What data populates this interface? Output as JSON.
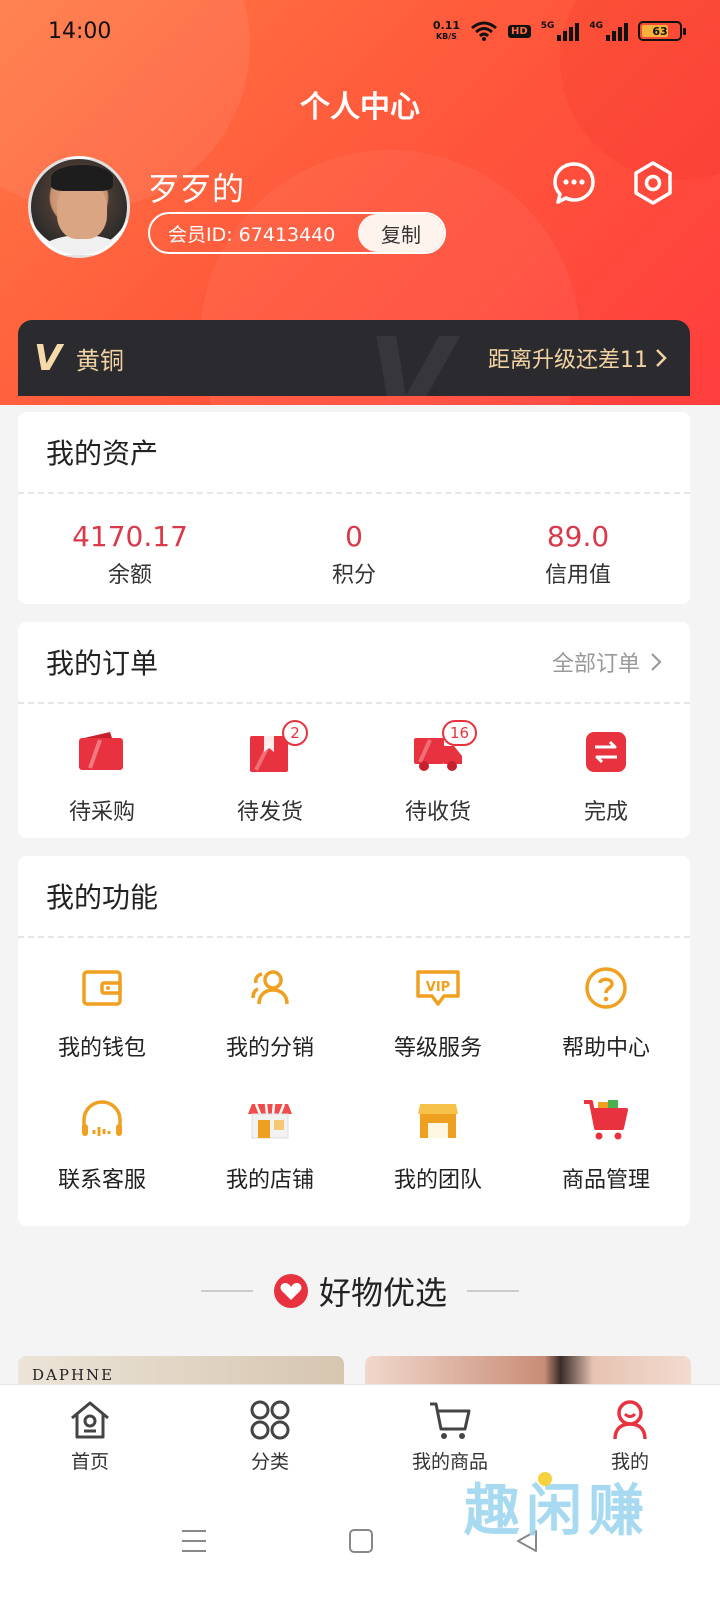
{
  "status_bar": {
    "time": "14:00",
    "net_speed_value": "0.11",
    "net_speed_unit": "KB/S",
    "hd_badge": "HD",
    "sig1_label": "5G",
    "sig2_label": "4G",
    "battery": "63"
  },
  "header": {
    "title": "个人中心"
  },
  "profile": {
    "username": "歹歹的",
    "member_id": "会员ID: 67413440",
    "copy_label": "复制"
  },
  "level": {
    "name": "黄铜",
    "upgrade_text": "距离升级还差11"
  },
  "assets": {
    "title": "我的资产",
    "items": [
      {
        "value": "4170.17",
        "label": "余额"
      },
      {
        "value": "0",
        "label": "积分"
      },
      {
        "value": "89.0",
        "label": "信用值"
      }
    ]
  },
  "orders": {
    "title": "我的订单",
    "all_label": "全部订单",
    "items": [
      {
        "label": "待采购",
        "badge": "",
        "icon": "wallet-icon"
      },
      {
        "label": "待发货",
        "badge": "2",
        "icon": "package-icon"
      },
      {
        "label": "待收货",
        "badge": "16",
        "icon": "truck-icon"
      },
      {
        "label": "完成",
        "badge": "",
        "icon": "exchange-icon"
      }
    ]
  },
  "functions": {
    "title": "我的功能",
    "items": [
      {
        "label": "我的钱包",
        "icon": "wallet-outline-icon"
      },
      {
        "label": "我的分销",
        "icon": "users-icon"
      },
      {
        "label": "等级服务",
        "icon": "vip-icon"
      },
      {
        "label": "帮助中心",
        "icon": "help-icon"
      },
      {
        "label": "联系客服",
        "icon": "headset-icon"
      },
      {
        "label": "我的店铺",
        "icon": "shop-icon"
      },
      {
        "label": "我的团队",
        "icon": "storefront-icon"
      },
      {
        "label": "商品管理",
        "icon": "cart-icon"
      }
    ]
  },
  "featured": {
    "title": "好物优选",
    "product1_brand": "DAPHNE"
  },
  "bottom_nav": {
    "items": [
      {
        "label": "首页",
        "icon": "home-icon"
      },
      {
        "label": "分类",
        "icon": "grid-icon"
      },
      {
        "label": "我的商品",
        "icon": "cart-outline-icon"
      },
      {
        "label": "我的",
        "icon": "user-icon",
        "active": true
      }
    ]
  },
  "watermark": "趣闲赚",
  "colors": {
    "accent": "#e8323f",
    "header_start": "#ff7a45",
    "header_end": "#ff3d3d",
    "gold": "#f0a020",
    "level_text": "#f1d2a2"
  }
}
